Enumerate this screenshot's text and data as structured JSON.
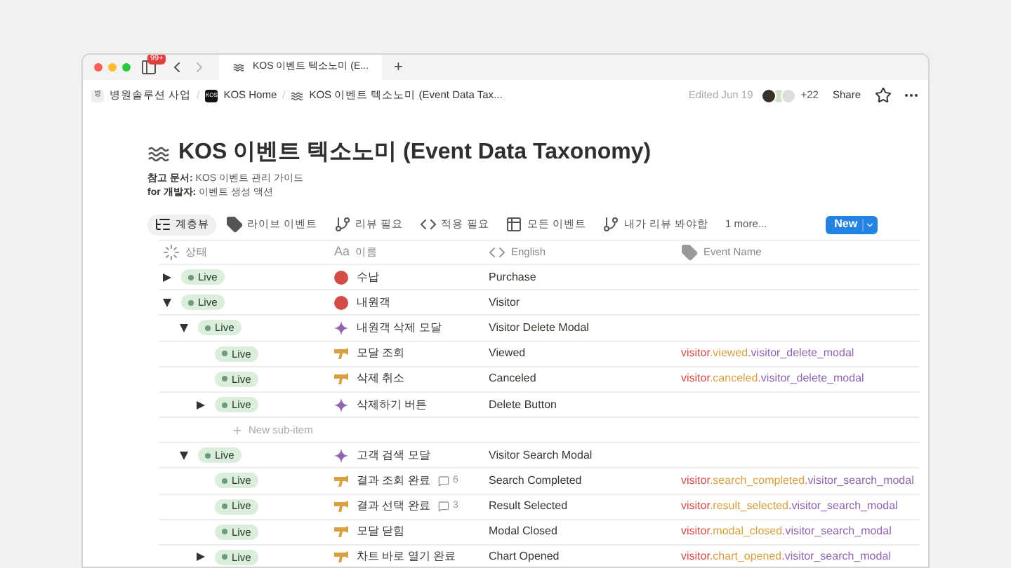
{
  "browser": {
    "badge": "99+",
    "tab_title": "KOS 이벤트 텍소노미 (E...",
    "new_tab": "+"
  },
  "breadcrumb": [
    {
      "icon": "병",
      "label": "병원솔루션 사업"
    },
    {
      "separator": "/",
      "icon": "KOS",
      "label": "KOS Home"
    },
    {
      "separator": "/",
      "label": "KOS 이벤트 텍소노미 (Event Data Tax..."
    }
  ],
  "topbar": {
    "edited": "Edited Jun 19",
    "extra_count": "+22",
    "share": "Share"
  },
  "page": {
    "title": "KOS 이벤트 텍소노미 (Event Data Taxonomy)",
    "props": [
      {
        "label": "참고 문서:",
        "value": "KOS 이벤트 관리 가이드"
      },
      {
        "label": "for 개발자:",
        "value": "이벤트 생성 액션"
      }
    ]
  },
  "views": [
    {
      "kind": "tree",
      "label": "계층뷰",
      "selected": true
    },
    {
      "kind": "tag",
      "label": "라이브 이벤트",
      "selected": false
    },
    {
      "kind": "branch",
      "label": "리뷰 필요",
      "selected": false
    },
    {
      "kind": "code",
      "label": "적용 필요",
      "selected": false
    },
    {
      "kind": "table",
      "label": "모든 이벤트",
      "selected": false
    },
    {
      "kind": "branch",
      "label": "내가 리뷰 봐야함",
      "selected": false
    },
    {
      "kind": "more",
      "label": "1 more...",
      "selected": false
    }
  ],
  "new_button": "New",
  "table": {
    "columns": [
      {
        "kind": "status",
        "label": "상태"
      },
      {
        "kind": "title",
        "icon_label": "Aa",
        "label": "이름"
      },
      {
        "kind": "code",
        "label": "English"
      },
      {
        "kind": "tag",
        "label": "Event Name"
      }
    ],
    "rows": [
      {
        "kind": "category",
        "status": "Live",
        "name": "수납",
        "english": "Purchase",
        "expanded": false
      },
      {
        "kind": "category",
        "status": "Live",
        "name": "내원객",
        "english": "Visitor",
        "expanded": true,
        "children": [
          {
            "kind": "screen",
            "status": "Live",
            "name": "내원객 삭제 모달",
            "english": "Visitor Delete Modal",
            "expanded": true,
            "new_item": "New sub-item",
            "children": [
              {
                "kind": "event",
                "status": "Live",
                "name": "모달 조회",
                "english": "Viewed",
                "event_name": [
                  {
                    "text": "visitor",
                    "color": "#d44c47"
                  },
                  {
                    "text": ".viewed",
                    "color": "#d9a03f"
                  },
                  {
                    "text": ".visitor_delete_modal",
                    "color": "#9065b0"
                  }
                ]
              },
              {
                "kind": "event",
                "status": "Live",
                "name": "삭제 취소",
                "english": "Canceled",
                "event_name": [
                  {
                    "text": "visitor",
                    "color": "#d44c47"
                  },
                  {
                    "text": ".canceled",
                    "color": "#d9a03f"
                  },
                  {
                    "text": ".visitor_delete_modal",
                    "color": "#9065b0"
                  }
                ]
              },
              {
                "kind": "screen",
                "status": "Live",
                "name": "삭제하기 버튼",
                "english": "Delete Button",
                "expanded": false
              }
            ]
          },
          {
            "kind": "screen",
            "status": "Live",
            "name": "고객 검색 모달",
            "english": "Visitor Search Modal",
            "expanded": true,
            "children": [
              {
                "kind": "event",
                "status": "Live",
                "name": "결과 조회 완료",
                "comments": "6",
                "english": "Search Completed",
                "event_name": [
                  {
                    "text": "visitor",
                    "color": "#d44c47"
                  },
                  {
                    "text": ".search_completed",
                    "color": "#d9a03f"
                  },
                  {
                    "text": ".visitor_search_modal",
                    "color": "#9065b0"
                  }
                ]
              },
              {
                "kind": "event",
                "status": "Live",
                "name": "결과 선택 완료",
                "comments": "3",
                "english": "Result Selected",
                "event_name": [
                  {
                    "text": "visitor",
                    "color": "#d44c47"
                  },
                  {
                    "text": ".result_selected",
                    "color": "#d9a03f"
                  },
                  {
                    "text": ".visitor_search_modal",
                    "color": "#9065b0"
                  }
                ]
              },
              {
                "kind": "event",
                "status": "Live",
                "name": "모달 닫힘",
                "english": "Modal Closed",
                "event_name": [
                  {
                    "text": "visitor",
                    "color": "#d44c47"
                  },
                  {
                    "text": ".modal_closed",
                    "color": "#d9a03f"
                  },
                  {
                    "text": ".visitor_search_modal",
                    "color": "#9065b0"
                  }
                ]
              },
              {
                "kind": "event",
                "status": "Live",
                "name": "차트 바로 열기 완료",
                "english": "Chart Opened",
                "expanded": false,
                "event_name": [
                  {
                    "text": "visitor",
                    "color": "#d44c47"
                  },
                  {
                    "text": ".chart_opened",
                    "color": "#d9a03f"
                  },
                  {
                    "text": ".visitor_search_modal",
                    "color": "#9065b0"
                  }
                ]
              }
            ]
          }
        ]
      }
    ]
  }
}
